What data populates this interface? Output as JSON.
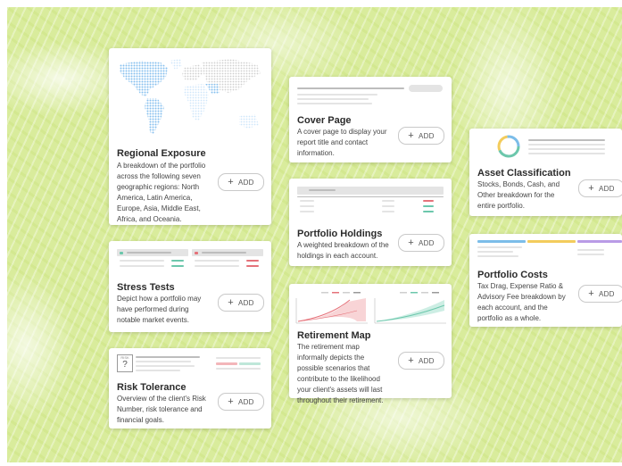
{
  "cards": {
    "regional": {
      "title": "Regional Exposure",
      "desc": "A breakdown of the portfolio across the following seven geographic regions: North America, Latin America, Europe, Asia, Middle East, Africa, and Oceania.",
      "add": "ADD"
    },
    "cover": {
      "title": "Cover Page",
      "desc": "A cover page to display your report title and contact information.",
      "add": "ADD"
    },
    "asset": {
      "title": "Asset Classification",
      "desc": "Stocks, Bonds, Cash, and Other breakdown for the entire portfolio.",
      "add": "ADD"
    },
    "holdings": {
      "title": "Portfolio Holdings",
      "desc": "A weighted breakdown of the holdings in each account.",
      "add": "ADD"
    },
    "costs": {
      "title": "Portfolio Costs",
      "desc": "Tax Drag, Expense Ratio & Advisory Fee breakdown by each account, and the portfolio as a whole.",
      "add": "ADD"
    },
    "stress": {
      "title": "Stress Tests",
      "desc": "Depict how a portfolio may have performed during notable market events.",
      "add": "ADD"
    },
    "retirement": {
      "title": "Retirement Map",
      "desc": "The retirement map informally depicts the possible scenarios that contribute to the likelihood your client's assets will last throughout their retirement.",
      "add": "ADD"
    },
    "risk": {
      "title": "Risk Tolerance",
      "desc": "Overview of the client's Risk Number, risk tolerance and financial goals.",
      "add": "ADD",
      "badge_label": "RISK",
      "badge_value": "?"
    }
  },
  "colors": {
    "background": "#d9ec9c",
    "map_dots": "#8bc3ee",
    "green": "#6cc7ac",
    "red": "#e5727a",
    "yellow": "#f3cc5c",
    "purple": "#b99be6",
    "blue": "#7cbde9"
  }
}
